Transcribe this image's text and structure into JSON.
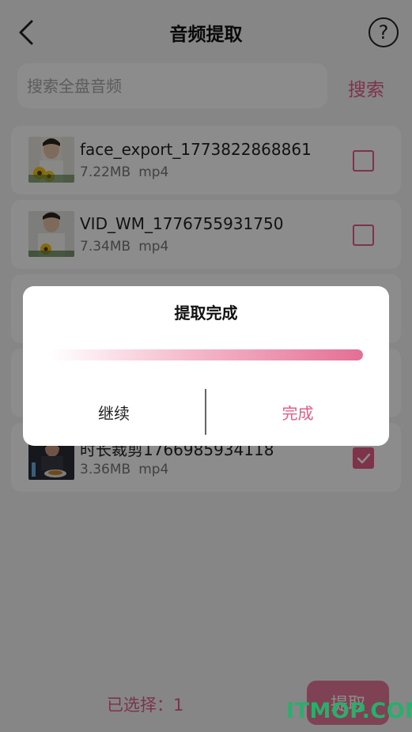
{
  "header": {
    "title": "音频提取",
    "back_icon": "chevron-left-icon",
    "help_icon": "question-circle-icon",
    "help_glyph": "?"
  },
  "search": {
    "placeholder": "搜索全盘音频",
    "value": "",
    "button_label": "搜索"
  },
  "files": [
    {
      "name": "face_export_1773822868861",
      "size": "7.22MB",
      "format": "mp4",
      "checked": false
    },
    {
      "name": "VID_WM_1776755931750",
      "size": "7.34MB",
      "format": "mp4",
      "checked": false
    },
    {
      "name": "时长裁剪1766985934118",
      "size": "3.36MB",
      "format": "mp4",
      "checked": true
    }
  ],
  "footer": {
    "selected_label": "已选择：1",
    "extract_label": "提取"
  },
  "watermark": "ITMOP.COM",
  "dialog": {
    "title": "提取完成",
    "progress": 1.0,
    "continue_label": "继续",
    "done_label": "完成"
  },
  "colors": {
    "accent": "#e45d87",
    "accent_light": "#e7789c",
    "watermark": "#27b06a"
  }
}
